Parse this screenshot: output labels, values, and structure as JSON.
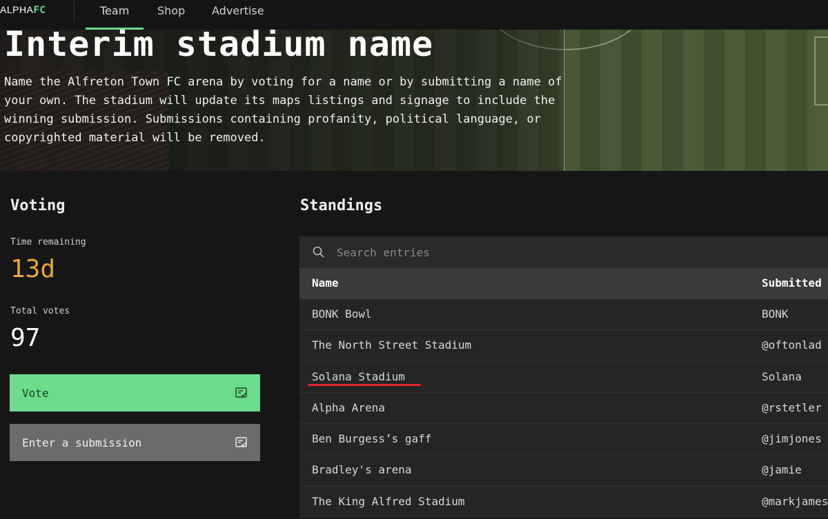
{
  "nav": {
    "logo_primary": "ALPHA",
    "logo_accent": "FC",
    "items": [
      {
        "label": "Team",
        "active": true
      },
      {
        "label": "Shop",
        "active": false
      },
      {
        "label": "Advertise",
        "active": false
      }
    ]
  },
  "hero": {
    "title": "Interim stadium name",
    "description": "Name the Alfreton Town FC arena by voting for a name or by submitting a name of your own. The stadium will update its maps listings and signage to include the winning submission. Submissions containing profanity, political language, or copyrighted material will be removed."
  },
  "voting": {
    "title": "Voting",
    "time_remaining_label": "Time remaining",
    "time_remaining_value": "13d",
    "total_votes_label": "Total votes",
    "total_votes_value": "97",
    "vote_button": "Vote",
    "submit_button": "Enter a submission"
  },
  "standings": {
    "title": "Standings",
    "search_placeholder": "Search entries",
    "columns": [
      "Name",
      "Submitted by"
    ],
    "rows": [
      {
        "name": "BONK Bowl",
        "submitted_by": "BONK"
      },
      {
        "name": "The North Street Stadium",
        "submitted_by": "@oftonlad"
      },
      {
        "name": "Solana Stadium",
        "submitted_by": "Solana"
      },
      {
        "name": "Alpha Arena",
        "submitted_by": "@rstetler"
      },
      {
        "name": "Ben Burgess’s gaff",
        "submitted_by": "@jimjones"
      },
      {
        "name": "Bradley's arena",
        "submitted_by": "@jamie"
      },
      {
        "name": "The King Alfred Stadium",
        "submitted_by": "@markjames"
      }
    ]
  },
  "colors": {
    "accent_green": "#6ddb8c",
    "time_orange": "#e8a832",
    "annotation_red": "#e0262a"
  },
  "icons": {
    "search": "search-icon",
    "vote": "ballot-check-icon",
    "submit": "ballot-check-icon"
  }
}
